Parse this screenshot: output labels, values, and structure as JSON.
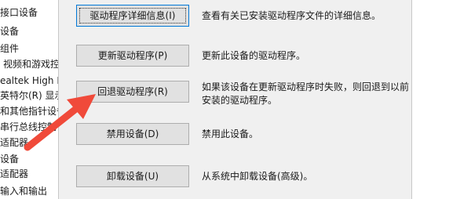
{
  "device_tree": {
    "items": [
      "接口设备",
      "设备",
      "组件",
      "视频和游戏控",
      "ealtek High D",
      "英特尔(R) 显示",
      "和其他指针设备",
      "串行总线控制",
      "适配器",
      "设备",
      "适配器",
      "输入和输出"
    ]
  },
  "driver_actions": [
    {
      "button_label": "驱动程序详细信息(I)",
      "description": "查看有关已安装驱动程序文件的详细信息。"
    },
    {
      "button_label": "更新驱动程序(P)",
      "description": "更新此设备的驱动程序。"
    },
    {
      "button_label": "回退驱动程序(R)",
      "description": "如果该设备在更新驱动程序时失败，则回退到以前安装的驱动程序。"
    },
    {
      "button_label": "禁用设备(D)",
      "description": "禁用此设备。"
    },
    {
      "button_label": "卸载设备(U)",
      "description": "从系统中卸载设备(高级)。"
    }
  ],
  "annotation": {
    "arrow_color": "#f04a3a"
  }
}
